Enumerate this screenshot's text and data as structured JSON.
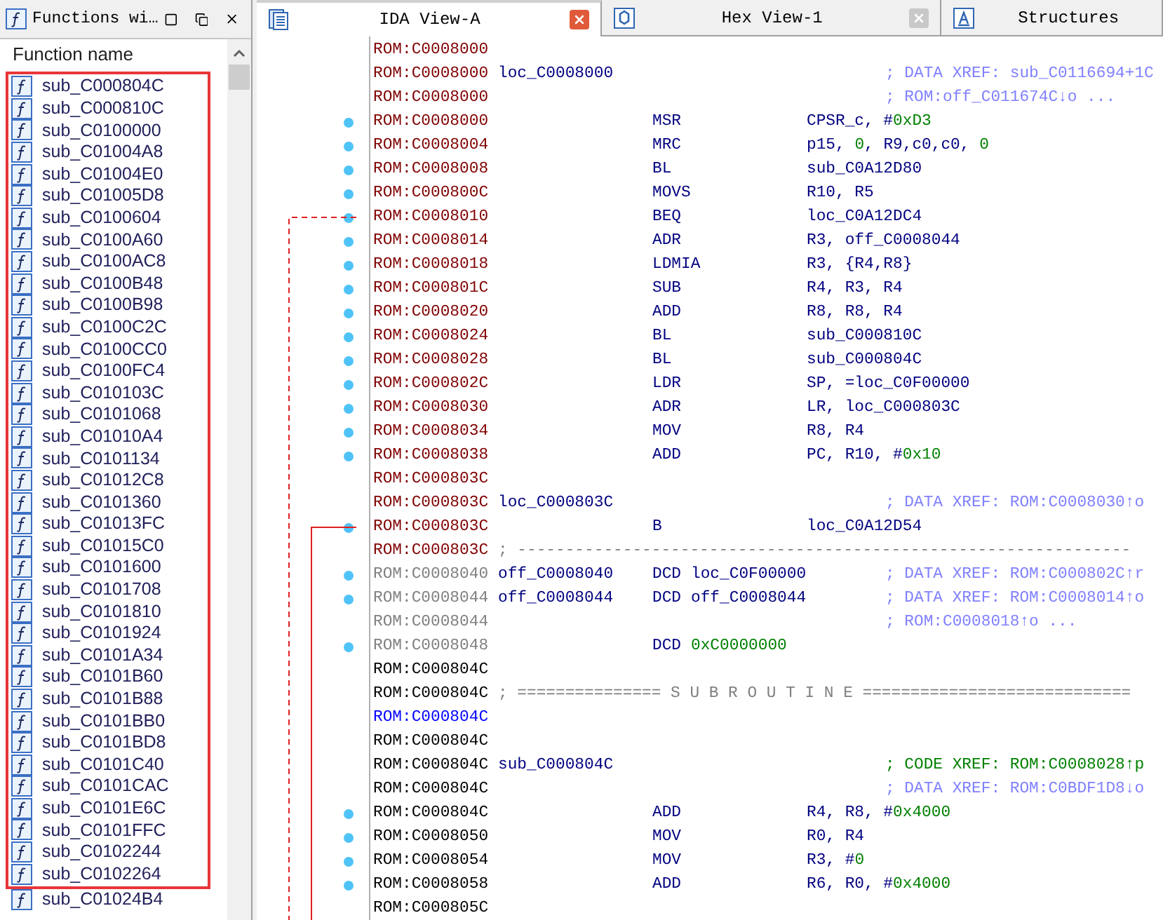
{
  "functions_panel": {
    "title": "Functions wi…",
    "column": "Function name",
    "items": [
      {
        "name": "sub_C000804C"
      },
      {
        "name": "sub_C000810C"
      },
      {
        "name": "sub_C0100000"
      },
      {
        "name": "sub_C01004A8"
      },
      {
        "name": "sub_C01004E0"
      },
      {
        "name": "sub_C01005D8"
      },
      {
        "name": "sub_C0100604"
      },
      {
        "name": "sub_C0100A60"
      },
      {
        "name": "sub_C0100AC8"
      },
      {
        "name": "sub_C0100B48"
      },
      {
        "name": "sub_C0100B98"
      },
      {
        "name": "sub_C0100C2C"
      },
      {
        "name": "sub_C0100CC0"
      },
      {
        "name": "sub_C0100FC4"
      },
      {
        "name": "sub_C010103C"
      },
      {
        "name": "sub_C0101068"
      },
      {
        "name": "sub_C01010A4"
      },
      {
        "name": "sub_C0101134"
      },
      {
        "name": "sub_C01012C8"
      },
      {
        "name": "sub_C0101360"
      },
      {
        "name": "sub_C01013FC"
      },
      {
        "name": "sub_C01015C0"
      },
      {
        "name": "sub_C0101600"
      },
      {
        "name": "sub_C0101708"
      },
      {
        "name": "sub_C0101810"
      },
      {
        "name": "sub_C0101924"
      },
      {
        "name": "sub_C0101A34"
      },
      {
        "name": "sub_C0101B60"
      },
      {
        "name": "sub_C0101B88"
      },
      {
        "name": "sub_C0101BB0"
      },
      {
        "name": "sub_C0101BD8"
      },
      {
        "name": "sub_C0101C40"
      },
      {
        "name": "sub_C0101CAC"
      },
      {
        "name": "sub_C0101E6C"
      },
      {
        "name": "sub_C0101FFC"
      },
      {
        "name": "sub_C0102244"
      },
      {
        "name": "sub_C0102264"
      },
      {
        "name": "sub_C01024B4"
      }
    ]
  },
  "tabs": [
    {
      "label": "IDA View-A",
      "kind": "disasm",
      "selected": true,
      "closable": true
    },
    {
      "label": "Hex View-1",
      "kind": "hex",
      "selected": false,
      "closable": true
    },
    {
      "label": "Structures",
      "kind": "struct",
      "selected": false,
      "closable": false
    }
  ],
  "listing": [
    {
      "kind": "plain",
      "address": {
        "text": "ROM:C0008000",
        "kind": "code"
      },
      "dot": false
    },
    {
      "kind": "plain",
      "address": {
        "text": "ROM:C0008000",
        "kind": "code"
      },
      "dot": false,
      "label": "loc_C0008000",
      "comment": {
        "text": "; DATA XREF: sub_C0116694+1C",
        "kind": "data"
      }
    },
    {
      "kind": "plain",
      "address": {
        "text": "ROM:C0008000",
        "kind": "code"
      },
      "dot": false,
      "comment": {
        "text": "; ROM:off_C011674C↓o ...",
        "kind": "data"
      }
    },
    {
      "kind": "instruction",
      "address": {
        "text": "ROM:C0008000",
        "kind": "code"
      },
      "dot": true,
      "mnemonic": "MSR",
      "operands": [
        {
          "text": "CPSR_c, #",
          "kind": "text"
        },
        {
          "text": "0xD3",
          "kind": "number"
        }
      ]
    },
    {
      "kind": "instruction",
      "address": {
        "text": "ROM:C0008004",
        "kind": "code"
      },
      "dot": true,
      "mnemonic": "MRC",
      "operands": [
        {
          "text": "p15, ",
          "kind": "text"
        },
        {
          "text": "0",
          "kind": "number"
        },
        {
          "text": ", R9,c0,c0, ",
          "kind": "text"
        },
        {
          "text": "0",
          "kind": "number"
        }
      ]
    },
    {
      "kind": "instruction",
      "address": {
        "text": "ROM:C0008008",
        "kind": "code"
      },
      "dot": true,
      "mnemonic": "BL",
      "operands": [
        {
          "text": "sub_C0A12D80",
          "kind": "text"
        }
      ]
    },
    {
      "kind": "instruction",
      "address": {
        "text": "ROM:C000800C",
        "kind": "code"
      },
      "dot": true,
      "mnemonic": "MOVS",
      "operands": [
        {
          "text": "R10, R5",
          "kind": "text"
        }
      ]
    },
    {
      "kind": "instruction",
      "address": {
        "text": "ROM:C0008010",
        "kind": "code"
      },
      "dot": true,
      "mnemonic": "BEQ",
      "operands": [
        {
          "text": "loc_C0A12DC4",
          "kind": "text"
        }
      ]
    },
    {
      "kind": "instruction",
      "address": {
        "text": "ROM:C0008014",
        "kind": "code"
      },
      "dot": true,
      "mnemonic": "ADR",
      "operands": [
        {
          "text": "R3, off_C0008044",
          "kind": "text"
        }
      ]
    },
    {
      "kind": "instruction",
      "address": {
        "text": "ROM:C0008018",
        "kind": "code"
      },
      "dot": true,
      "mnemonic": "LDMIA",
      "operands": [
        {
          "text": "R3, {R4,R8}",
          "kind": "text"
        }
      ]
    },
    {
      "kind": "instruction",
      "address": {
        "text": "ROM:C000801C",
        "kind": "code"
      },
      "dot": true,
      "mnemonic": "SUB",
      "operands": [
        {
          "text": "R4, R3, R4",
          "kind": "text"
        }
      ]
    },
    {
      "kind": "instruction",
      "address": {
        "text": "ROM:C0008020",
        "kind": "code"
      },
      "dot": true,
      "mnemonic": "ADD",
      "operands": [
        {
          "text": "R8, R8, R4",
          "kind": "text"
        }
      ]
    },
    {
      "kind": "instruction",
      "address": {
        "text": "ROM:C0008024",
        "kind": "code"
      },
      "dot": true,
      "mnemonic": "BL",
      "operands": [
        {
          "text": "sub_C000810C",
          "kind": "text"
        }
      ]
    },
    {
      "kind": "instruction",
      "address": {
        "text": "ROM:C0008028",
        "kind": "code"
      },
      "dot": true,
      "mnemonic": "BL",
      "operands": [
        {
          "text": "sub_C000804C",
          "kind": "text"
        }
      ]
    },
    {
      "kind": "instruction",
      "address": {
        "text": "ROM:C000802C",
        "kind": "code"
      },
      "dot": true,
      "mnemonic": "LDR",
      "operands": [
        {
          "text": "SP, =loc_C0F00000",
          "kind": "text"
        }
      ]
    },
    {
      "kind": "instruction",
      "address": {
        "text": "ROM:C0008030",
        "kind": "code"
      },
      "dot": true,
      "mnemonic": "ADR",
      "operands": [
        {
          "text": "LR, loc_C000803C",
          "kind": "text"
        }
      ]
    },
    {
      "kind": "instruction",
      "address": {
        "text": "ROM:C0008034",
        "kind": "code"
      },
      "dot": true,
      "mnemonic": "MOV",
      "operands": [
        {
          "text": "R8, R4",
          "kind": "text"
        }
      ]
    },
    {
      "kind": "instruction",
      "address": {
        "text": "ROM:C0008038",
        "kind": "code"
      },
      "dot": true,
      "mnemonic": "ADD",
      "operands": [
        {
          "text": "PC, R10, #",
          "kind": "text"
        },
        {
          "text": "0x10",
          "kind": "number"
        }
      ]
    },
    {
      "kind": "plain",
      "address": {
        "text": "ROM:C000803C",
        "kind": "code"
      },
      "dot": false
    },
    {
      "kind": "plain",
      "address": {
        "text": "ROM:C000803C",
        "kind": "code"
      },
      "dot": false,
      "label": "loc_C000803C",
      "comment": {
        "text": "; DATA XREF: ROM:C0008030↑o",
        "kind": "data"
      }
    },
    {
      "kind": "instruction",
      "address": {
        "text": "ROM:C000803C",
        "kind": "code"
      },
      "dot": true,
      "mnemonic": "B",
      "operands": [
        {
          "text": "loc_C0A12D54",
          "kind": "text"
        }
      ]
    },
    {
      "kind": "separator",
      "address": {
        "text": "ROM:C000803C",
        "kind": "code"
      },
      "dot": false,
      "separator": "; ----------------------------------------------------------------"
    },
    {
      "kind": "data",
      "address": {
        "text": "ROM:C0008040",
        "kind": "data"
      },
      "dot": true,
      "label": "off_C0008040",
      "mnemonic": "DCD",
      "operands": [
        {
          "text": "loc_C0F00000",
          "kind": "text"
        }
      ],
      "comment": {
        "text": "; DATA XREF: ROM:C000802C↑r",
        "kind": "data"
      }
    },
    {
      "kind": "data",
      "address": {
        "text": "ROM:C0008044",
        "kind": "data"
      },
      "dot": true,
      "label": "off_C0008044",
      "mnemonic": "DCD",
      "operands": [
        {
          "text": "off_C0008044",
          "kind": "text"
        }
      ],
      "comment": {
        "text": "; DATA XREF: ROM:C0008014↑o",
        "kind": "data"
      }
    },
    {
      "kind": "plain",
      "address": {
        "text": "ROM:C0008044",
        "kind": "data"
      },
      "dot": false,
      "comment": {
        "text": "; ROM:C0008018↑o ...",
        "kind": "data"
      }
    },
    {
      "kind": "data",
      "address": {
        "text": "ROM:C0008048",
        "kind": "data"
      },
      "dot": true,
      "mnemonic": "DCD",
      "operands": [
        {
          "text": "0xC0000000",
          "kind": "number"
        }
      ]
    },
    {
      "kind": "plain",
      "address": {
        "text": "ROM:C000804C",
        "kind": "plain"
      },
      "dot": false
    },
    {
      "kind": "separator",
      "address": {
        "text": "ROM:C000804C",
        "kind": "plain"
      },
      "dot": false,
      "separator": "; =============== S U B R O U T I N E ============================"
    },
    {
      "kind": "plain",
      "address": {
        "text": "ROM:C000804C",
        "kind": "current"
      },
      "dot": false
    },
    {
      "kind": "plain",
      "address": {
        "text": "ROM:C000804C",
        "kind": "plain"
      },
      "dot": false
    },
    {
      "kind": "plain",
      "address": {
        "text": "ROM:C000804C",
        "kind": "plain"
      },
      "dot": false,
      "label": "sub_C000804C",
      "comment": {
        "text": "; CODE XREF: ROM:C0008028↑p",
        "kind": "code"
      }
    },
    {
      "kind": "plain",
      "address": {
        "text": "ROM:C000804C",
        "kind": "plain"
      },
      "dot": false,
      "comment": {
        "text": "; DATA XREF: ROM:C0BDF1D8↓o",
        "kind": "data"
      }
    },
    {
      "kind": "instruction",
      "address": {
        "text": "ROM:C000804C",
        "kind": "plain"
      },
      "dot": true,
      "mnemonic": "ADD",
      "operands": [
        {
          "text": "R4, R8, #",
          "kind": "text"
        },
        {
          "text": "0x4000",
          "kind": "number"
        }
      ]
    },
    {
      "kind": "instruction",
      "address": {
        "text": "ROM:C0008050",
        "kind": "plain"
      },
      "dot": true,
      "mnemonic": "MOV",
      "operands": [
        {
          "text": "R0, R4",
          "kind": "text"
        }
      ]
    },
    {
      "kind": "instruction",
      "address": {
        "text": "ROM:C0008054",
        "kind": "plain"
      },
      "dot": true,
      "mnemonic": "MOV",
      "operands": [
        {
          "text": "R3, #",
          "kind": "text"
        },
        {
          "text": "0",
          "kind": "number"
        }
      ]
    },
    {
      "kind": "instruction",
      "address": {
        "text": "ROM:C0008058",
        "kind": "plain"
      },
      "dot": true,
      "mnemonic": "ADD",
      "operands": [
        {
          "text": "R6, R0, #",
          "kind": "text"
        },
        {
          "text": "0x4000",
          "kind": "number"
        }
      ]
    },
    {
      "kind": "plain",
      "address": {
        "text": "ROM:C000805C",
        "kind": "plain"
      },
      "dot": false
    }
  ]
}
